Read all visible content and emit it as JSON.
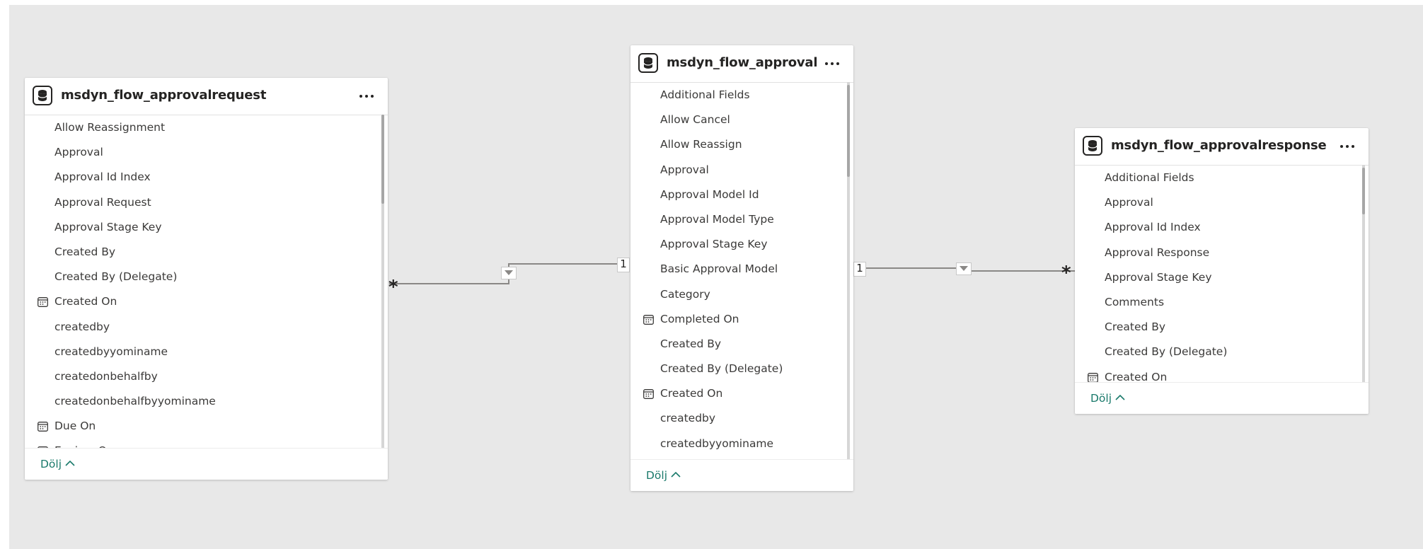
{
  "tables": [
    {
      "title": "msdyn_flow_approvalrequest",
      "fields": [
        {
          "label": "Allow Reassignment",
          "icon": ""
        },
        {
          "label": "Approval",
          "icon": ""
        },
        {
          "label": "Approval Id Index",
          "icon": ""
        },
        {
          "label": "Approval Request",
          "icon": ""
        },
        {
          "label": "Approval Stage Key",
          "icon": ""
        },
        {
          "label": "Created By",
          "icon": ""
        },
        {
          "label": "Created By (Delegate)",
          "icon": ""
        },
        {
          "label": "Created On",
          "icon": "calendar-icon"
        },
        {
          "label": "createdby",
          "icon": ""
        },
        {
          "label": "createdbyyominame",
          "icon": ""
        },
        {
          "label": "createdonbehalfby",
          "icon": ""
        },
        {
          "label": "createdonbehalfbyyominame",
          "icon": ""
        },
        {
          "label": "Due On",
          "icon": "calendar-icon"
        },
        {
          "label": "Expires On",
          "icon": "calendar-icon"
        }
      ],
      "collapse_label": "Dölj"
    },
    {
      "title": "msdyn_flow_approval",
      "fields": [
        {
          "label": "Additional Fields",
          "icon": ""
        },
        {
          "label": "Allow Cancel",
          "icon": ""
        },
        {
          "label": "Allow Reassign",
          "icon": ""
        },
        {
          "label": "Approval",
          "icon": ""
        },
        {
          "label": "Approval Model Id",
          "icon": ""
        },
        {
          "label": "Approval Model Type",
          "icon": ""
        },
        {
          "label": "Approval Stage Key",
          "icon": ""
        },
        {
          "label": "Basic Approval Model",
          "icon": ""
        },
        {
          "label": "Category",
          "icon": ""
        },
        {
          "label": "Completed On",
          "icon": "calendar-icon"
        },
        {
          "label": "Created By",
          "icon": ""
        },
        {
          "label": "Created By (Delegate)",
          "icon": ""
        },
        {
          "label": "Created On",
          "icon": "calendar-icon"
        },
        {
          "label": "createdby",
          "icon": ""
        },
        {
          "label": "createdbyyominame",
          "icon": ""
        }
      ],
      "collapse_label": "Dölj"
    },
    {
      "title": "msdyn_flow_approvalresponse",
      "fields": [
        {
          "label": "Additional Fields",
          "icon": ""
        },
        {
          "label": "Approval",
          "icon": ""
        },
        {
          "label": "Approval Id Index",
          "icon": ""
        },
        {
          "label": "Approval Response",
          "icon": ""
        },
        {
          "label": "Approval Stage Key",
          "icon": ""
        },
        {
          "label": "Comments",
          "icon": ""
        },
        {
          "label": "Created By",
          "icon": ""
        },
        {
          "label": "Created By (Delegate)",
          "icon": ""
        },
        {
          "label": "Created On",
          "icon": "calendar-icon"
        }
      ],
      "collapse_label": "Dölj"
    }
  ],
  "relationships": [
    {
      "from_cardinality": "*",
      "to_cardinality": "1"
    },
    {
      "from_cardinality": "1",
      "to_cardinality": "*"
    }
  ],
  "colors": {
    "canvas": "#e8e8e8",
    "accent": "#1a7a6b",
    "text": "#252423",
    "line": "#8a8886"
  }
}
